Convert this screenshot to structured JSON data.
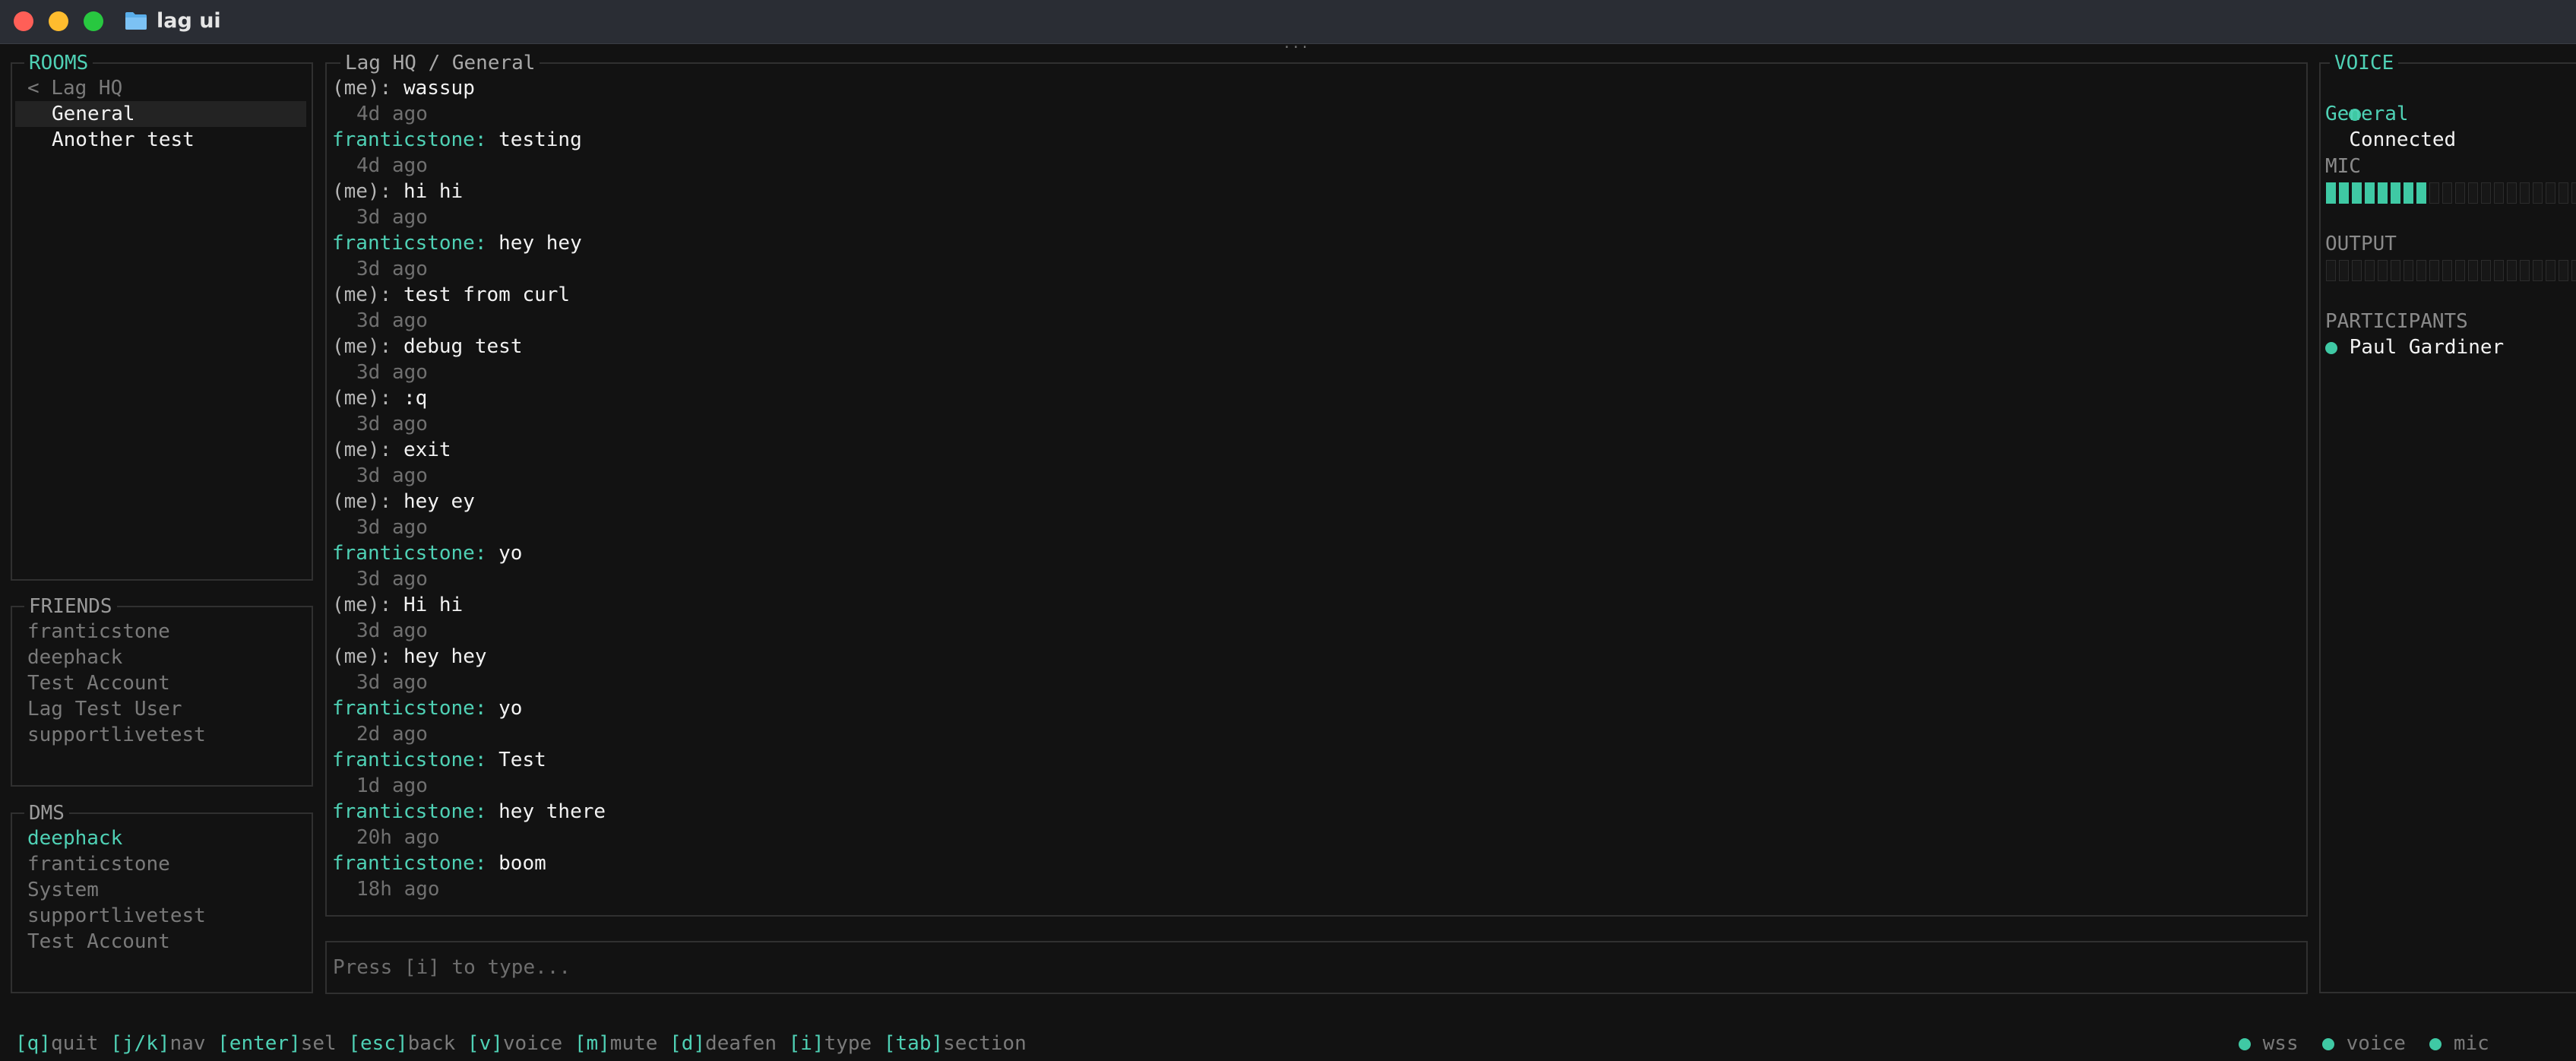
{
  "window": {
    "title": "lag ui"
  },
  "rooms": {
    "title": "ROOMS",
    "back_label": "< Lag HQ",
    "items": [
      {
        "label": "General",
        "selected": true
      },
      {
        "label": "Another test",
        "selected": false
      }
    ]
  },
  "friends": {
    "title": "FRIENDS",
    "items": [
      "franticstone",
      "deephack",
      "Test Account",
      "Lag Test User",
      "supportlivetest"
    ]
  },
  "dms": {
    "title": "DMS",
    "items": [
      "deephack",
      "franticstone",
      "System",
      "supportlivetest",
      "Test Account"
    ]
  },
  "chat": {
    "title": "Lag HQ / General",
    "messages": [
      {
        "user": "(me):",
        "text": "wassup",
        "time": "4d ago",
        "is_me": true
      },
      {
        "user": "franticstone:",
        "text": "testing",
        "time": "4d ago",
        "is_me": false
      },
      {
        "user": "(me):",
        "text": "hi hi",
        "time": "3d ago",
        "is_me": true
      },
      {
        "user": "franticstone:",
        "text": "hey hey",
        "time": "3d ago",
        "is_me": false
      },
      {
        "user": "(me):",
        "text": "test from curl",
        "time": "3d ago",
        "is_me": true
      },
      {
        "user": "(me):",
        "text": "debug test",
        "time": "3d ago",
        "is_me": true
      },
      {
        "user": "(me):",
        "text": ":q",
        "time": "3d ago",
        "is_me": true
      },
      {
        "user": "(me):",
        "text": "exit",
        "time": "3d ago",
        "is_me": true
      },
      {
        "user": "(me):",
        "text": "hey ey",
        "time": "3d ago",
        "is_me": true
      },
      {
        "user": "franticstone:",
        "text": "yo",
        "time": "3d ago",
        "is_me": false
      },
      {
        "user": "(me):",
        "text": "Hi hi",
        "time": "3d ago",
        "is_me": true
      },
      {
        "user": "(me):",
        "text": "hey hey",
        "time": "3d ago",
        "is_me": true
      },
      {
        "user": "franticstone:",
        "text": "yo",
        "time": "2d ago",
        "is_me": false
      },
      {
        "user": "franticstone:",
        "text": "Test",
        "time": "1d ago",
        "is_me": false
      },
      {
        "user": "franticstone:",
        "text": "hey there",
        "time": "20h ago",
        "is_me": false
      },
      {
        "user": "franticstone:",
        "text": "boom",
        "time": "18h ago",
        "is_me": false
      }
    ]
  },
  "input": {
    "placeholder": "Press [i] to type..."
  },
  "voice": {
    "title": "VOICE",
    "status": "Connected",
    "channel": "General",
    "mic_label": "MIC",
    "mic_level_segments": 8,
    "output_label": "OUTPUT",
    "output_level_segments": 0,
    "meter_total_segments": 20,
    "participants_label": "PARTICIPANTS",
    "participants": [
      "Paul Gardiner"
    ]
  },
  "statusbar": {
    "hints": [
      {
        "key": "[q]",
        "label": "quit"
      },
      {
        "key": "[j/k]",
        "label": "nav"
      },
      {
        "key": "[enter]",
        "label": "sel"
      },
      {
        "key": "[esc]",
        "label": "back"
      },
      {
        "key": "[v]",
        "label": "voice"
      },
      {
        "key": "[m]",
        "label": "mute"
      },
      {
        "key": "[d]",
        "label": "deafen"
      },
      {
        "key": "[i]",
        "label": "type"
      },
      {
        "key": "[tab]",
        "label": "section"
      }
    ],
    "indicators": [
      "wss",
      "voice",
      "mic"
    ]
  },
  "colors": {
    "accent": "#4fd1b5",
    "meter_on": "#3fc9a4",
    "background": "#121212"
  }
}
